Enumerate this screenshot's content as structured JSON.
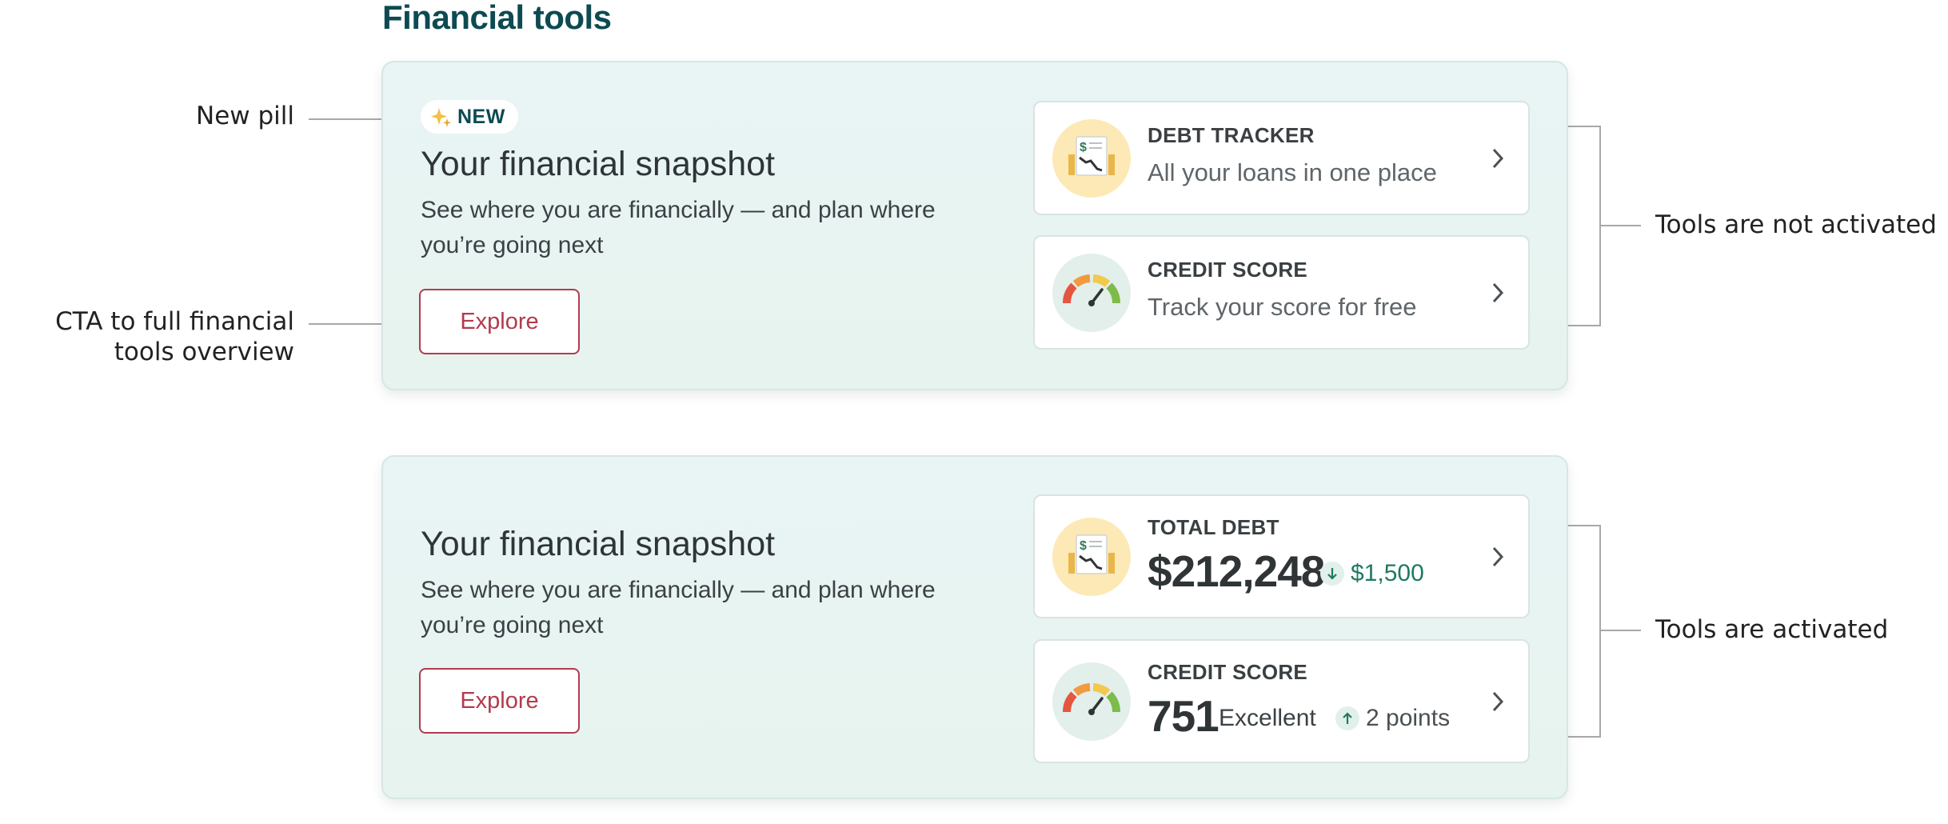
{
  "page": {
    "title": "Financial tools"
  },
  "annotations": {
    "new_pill": "New pill",
    "cta_line1": "CTA to full financial",
    "cta_line2": "tools overview",
    "not_activated": "Tools are not activated",
    "activated": "Tools are activated"
  },
  "card_inactive": {
    "pill_label": "NEW",
    "title": "Your financial snapshot",
    "desc_line1": "See where you are financially — and plan where",
    "desc_line2": "you’re going next",
    "button": "Explore",
    "tools": [
      {
        "label": "DEBT TRACKER",
        "sub": "All your loans in one place",
        "icon": "debt-ledger-icon"
      },
      {
        "label": "CREDIT SCORE",
        "sub": "Track your score for free",
        "icon": "credit-gauge-icon"
      }
    ]
  },
  "card_active": {
    "title": "Your financial snapshot",
    "desc_line1": "See where you are financially — and plan where",
    "desc_line2": "you’re going next",
    "button": "Explore",
    "debt": {
      "label": "TOTAL DEBT",
      "value": "$212,248",
      "delta": "$1,500",
      "delta_direction": "down"
    },
    "credit": {
      "label": "CREDIT SCORE",
      "value": "751",
      "rating": "Excellent",
      "delta": "2 points",
      "delta_direction": "up"
    }
  },
  "colors": {
    "brand_teal": "#0d4a52",
    "cta_red": "#b23b4e",
    "positive_green": "#1f7a63",
    "debt_icon_bg": "#fde9b6",
    "credit_icon_bg": "#e2efea"
  }
}
